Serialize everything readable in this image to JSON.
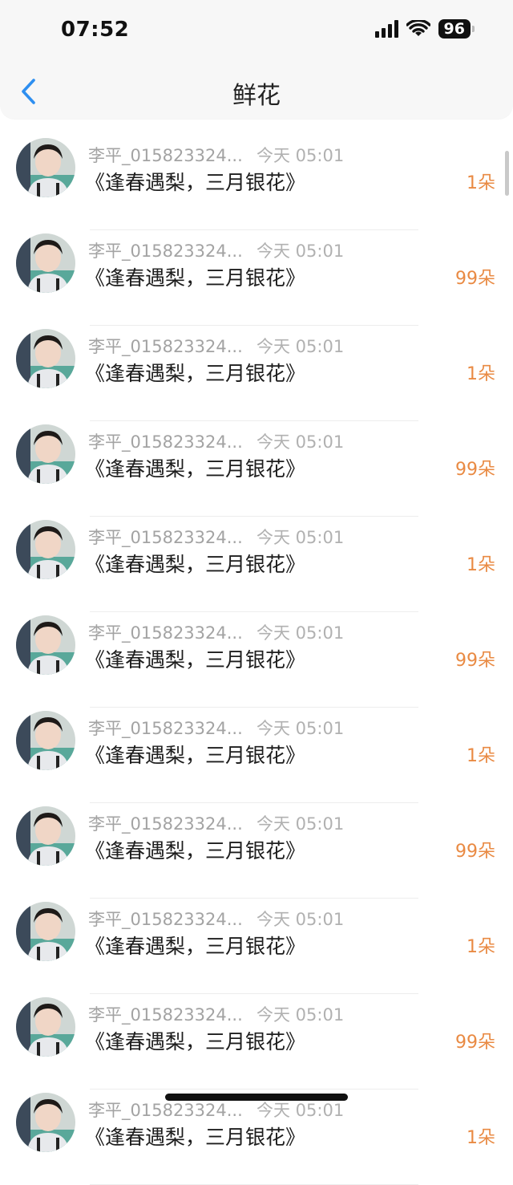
{
  "status": {
    "time": "07:52",
    "battery": "96"
  },
  "nav": {
    "title": "鲜花"
  },
  "list": [
    {
      "name": "李平_015823324...",
      "time": "今天 05:01",
      "title": "《逢春遇梨，三月银花》",
      "count": "1朵"
    },
    {
      "name": "李平_015823324...",
      "time": "今天 05:01",
      "title": "《逢春遇梨，三月银花》",
      "count": "99朵"
    },
    {
      "name": "李平_015823324...",
      "time": "今天 05:01",
      "title": "《逢春遇梨，三月银花》",
      "count": "1朵"
    },
    {
      "name": "李平_015823324...",
      "time": "今天 05:01",
      "title": "《逢春遇梨，三月银花》",
      "count": "99朵"
    },
    {
      "name": "李平_015823324...",
      "time": "今天 05:01",
      "title": "《逢春遇梨，三月银花》",
      "count": "1朵"
    },
    {
      "name": "李平_015823324...",
      "time": "今天 05:01",
      "title": "《逢春遇梨，三月银花》",
      "count": "99朵"
    },
    {
      "name": "李平_015823324...",
      "time": "今天 05:01",
      "title": "《逢春遇梨，三月银花》",
      "count": "1朵"
    },
    {
      "name": "李平_015823324...",
      "time": "今天 05:01",
      "title": "《逢春遇梨，三月银花》",
      "count": "99朵"
    },
    {
      "name": "李平_015823324...",
      "time": "今天 05:01",
      "title": "《逢春遇梨，三月银花》",
      "count": "1朵"
    },
    {
      "name": "李平_015823324...",
      "time": "今天 05:01",
      "title": "《逢春遇梨，三月银花》",
      "count": "99朵"
    },
    {
      "name": "李平_015823324...",
      "time": "今天 05:01",
      "title": "《逢春遇梨，三月银花》",
      "count": "1朵"
    }
  ],
  "colors": {
    "accent": "#2e8ff0",
    "count": "#e98a43"
  }
}
